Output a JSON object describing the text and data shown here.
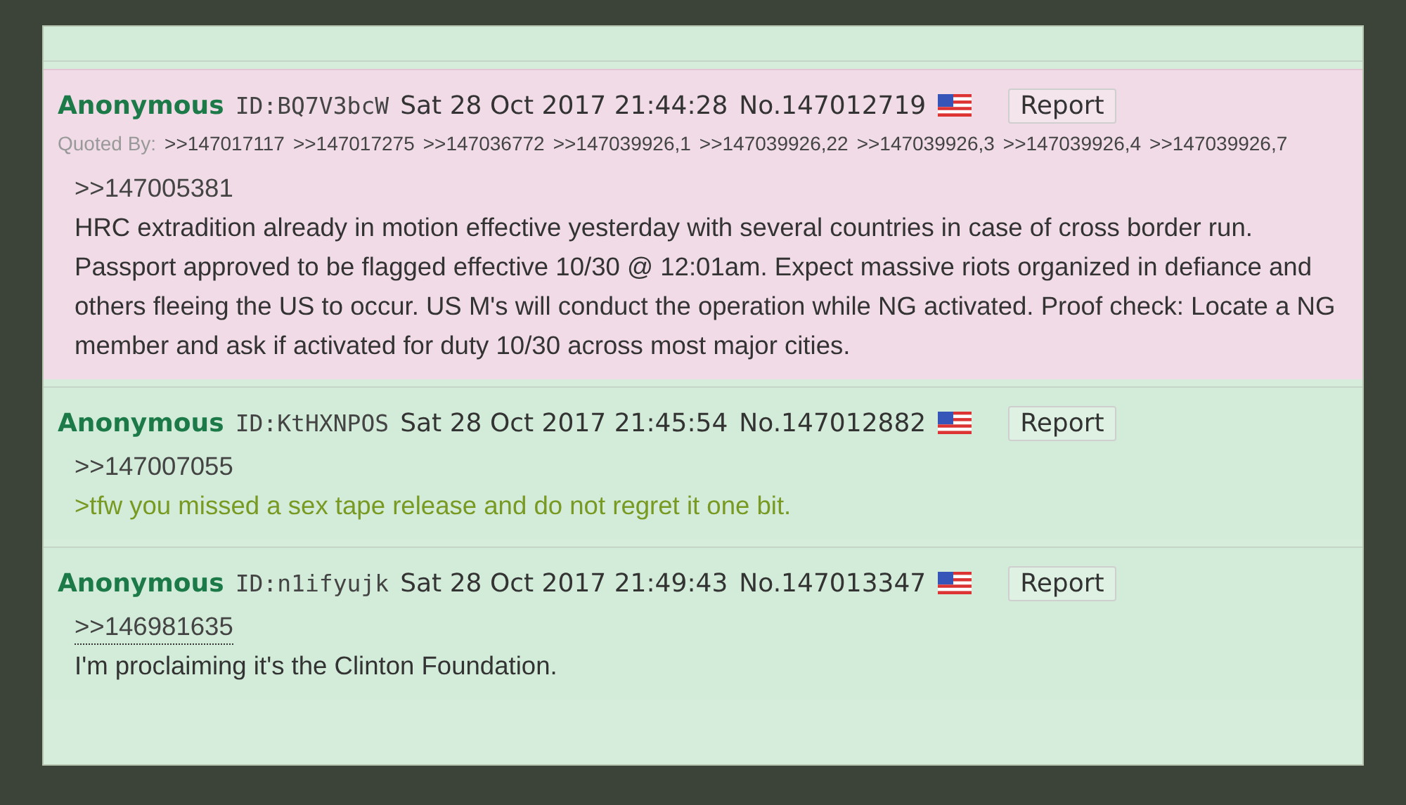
{
  "posts": [
    {
      "name": "Anonymous",
      "id": "ID:BQ7V3bcW",
      "date": "Sat 28 Oct 2017 21:44:28",
      "number": "No.147012719",
      "report": "Report",
      "highlighted": true,
      "quoted_by_label": "Quoted By:",
      "quoted_by": [
        ">>147017117",
        ">>147017275",
        ">>147036772",
        ">>147039926,1",
        ">>147039926,22",
        ">>147039926,3",
        ">>147039926,4",
        ">>147039926,7"
      ],
      "lines": [
        {
          "kind": "quote",
          "text": ">>147005381",
          "hovered": false
        },
        {
          "kind": "text",
          "text": "HRC extradition already in motion effective yesterday with several countries in case of cross border run. Passport approved to be flagged effective 10/30 @ 12:01am. Expect massive riots organized in defiance and others fleeing the US to occur. US M's will conduct the operation while NG activated. Proof check: Locate a NG member and ask if activated for duty 10/30 across most major cities."
        }
      ]
    },
    {
      "name": "Anonymous",
      "id": "ID:KtHXNPOS",
      "date": "Sat 28 Oct 2017 21:45:54",
      "number": "No.147012882",
      "report": "Report",
      "highlighted": false,
      "lines": [
        {
          "kind": "quote",
          "text": ">>147007055",
          "hovered": false
        },
        {
          "kind": "greentext",
          "text": ">tfw you missed a sex tape release and do not regret it one bit."
        }
      ]
    },
    {
      "name": "Anonymous",
      "id": "ID:n1ifyujk",
      "date": "Sat 28 Oct 2017 21:49:43",
      "number": "No.147013347",
      "report": "Report",
      "highlighted": false,
      "lines": [
        {
          "kind": "quote",
          "text": ">>146981635",
          "hovered": true
        },
        {
          "kind": "text",
          "text": "I'm proclaiming it's the Clinton Foundation."
        }
      ]
    }
  ]
}
